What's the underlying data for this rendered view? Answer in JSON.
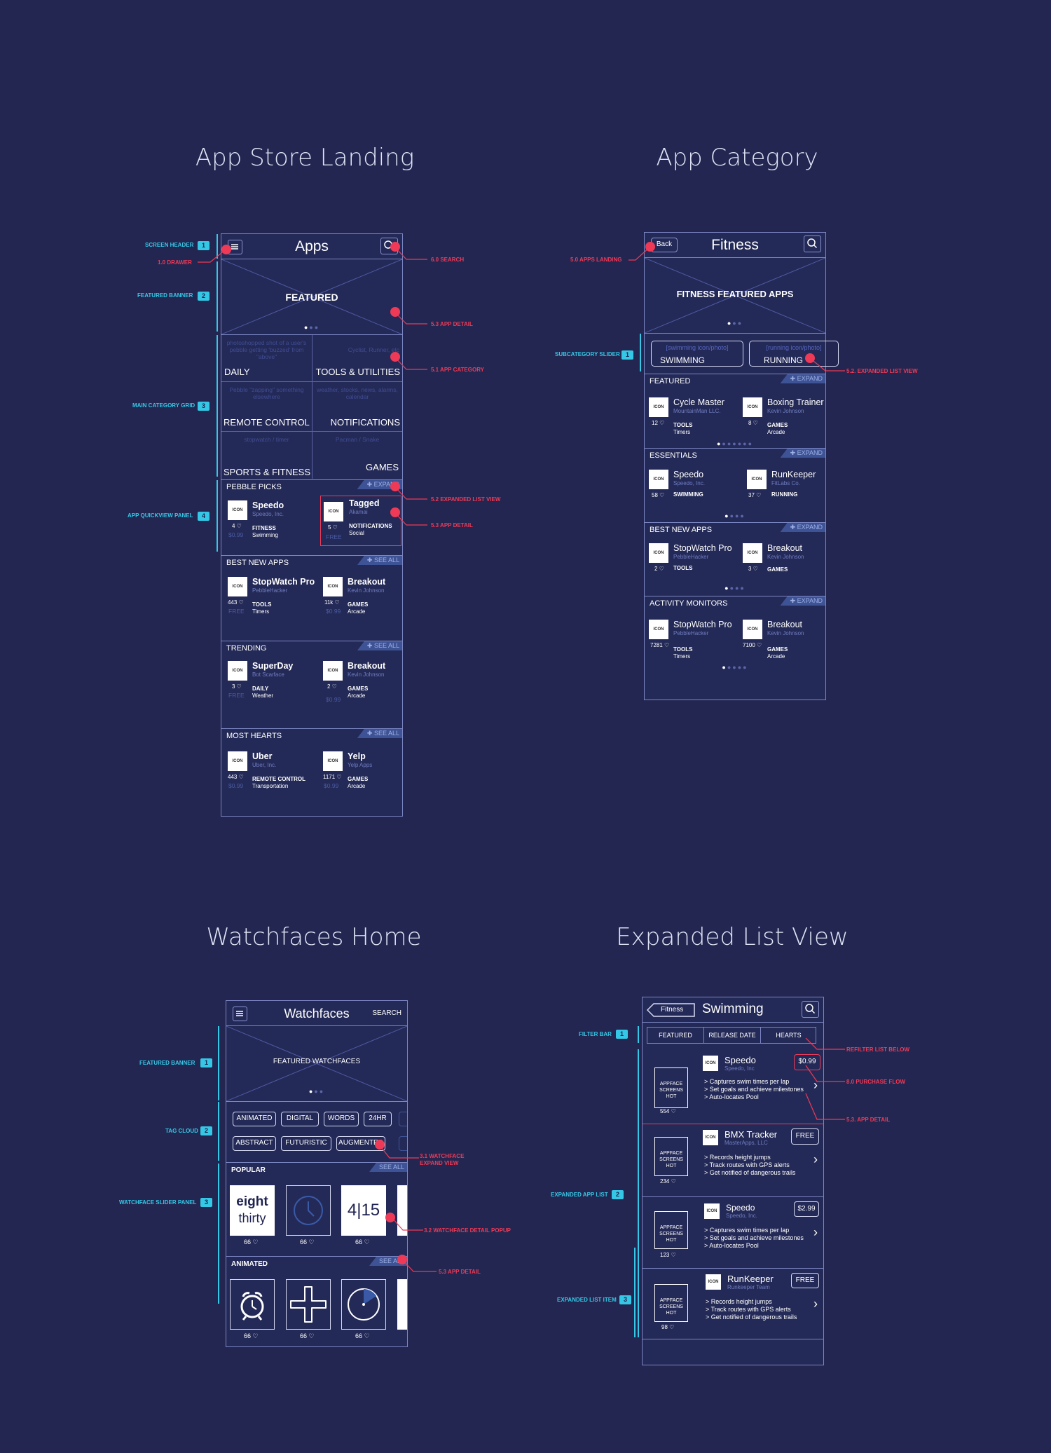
{
  "titles": {
    "landing": "App Store Landing",
    "category": "App Category",
    "watchfaces": "Watchfaces Home",
    "expanded": "Expanded List View"
  },
  "landing": {
    "header_title": "Apps",
    "banner": "FEATURED",
    "grid": [
      {
        "desc": "photoshopped shot of a user's pebble getting 'buzzed' from \"above\"",
        "name": "DAILY"
      },
      {
        "desc": "Cyclist, Runner, etc",
        "name": "TOOLS & UTILITIES"
      },
      {
        "desc": "Pebble \"zapping\" something elsewhere",
        "name": "REMOTE CONTROL"
      },
      {
        "desc": "weather, stocks, news, alarms, calendar",
        "name": "NOTIFICATIONS"
      },
      {
        "desc": "stopwatch / timer",
        "name": "SPORTS & FITNESS"
      },
      {
        "desc": "Pacman / Snake",
        "name": "GAMES"
      }
    ],
    "sections": [
      {
        "title": "PEBBLE PICKS",
        "action": "EXPAND",
        "apps": [
          {
            "icon": "ICON",
            "name": "Speedo",
            "dev": "Speedo, Inc.",
            "hearts": "4",
            "price": "$0.99",
            "cat": "FITNESS",
            "sub": "Swimming"
          },
          {
            "icon": "ICON",
            "name": "Tagged",
            "dev": "Akamai",
            "hearts": "5",
            "price": "FREE",
            "cat": "NOTIFICATIONS",
            "sub": "Social"
          }
        ]
      },
      {
        "title": "BEST NEW APPS",
        "action": "SEE ALL",
        "apps": [
          {
            "icon": "ICON",
            "name": "StopWatch Pro",
            "dev": "PebbleHacker",
            "hearts": "443",
            "price": "FREE",
            "cat": "TOOLS",
            "sub": "Timers"
          },
          {
            "icon": "ICON",
            "name": "Breakout",
            "dev": "Kevin Johnson",
            "hearts": "11k",
            "price": "$0.99",
            "cat": "GAMES",
            "sub": "Arcade"
          }
        ]
      },
      {
        "title": "TRENDING",
        "action": "SEE ALL",
        "apps": [
          {
            "icon": "ICON",
            "name": "SuperDay",
            "dev": "Bot Scarface",
            "hearts": "3",
            "price": "FREE",
            "cat": "DAILY",
            "sub": "Weather"
          },
          {
            "icon": "ICON",
            "name": "Breakout",
            "dev": "Kevin Johnson",
            "hearts": "2",
            "price": "$0.99",
            "cat": "GAMES",
            "sub": "Arcade"
          }
        ]
      },
      {
        "title": "MOST HEARTS",
        "action": "SEE ALL",
        "apps": [
          {
            "icon": "ICON",
            "name": "Uber",
            "dev": "Uber, Inc.",
            "hearts": "443",
            "price": "$0.99",
            "cat": "REMOTE CONTROL",
            "sub": "Transportation"
          },
          {
            "icon": "ICON",
            "name": "Yelp",
            "dev": "Yelp Apps",
            "hearts": "1171",
            "price": "$0.99",
            "cat": "GAMES",
            "sub": "Arcade"
          }
        ]
      }
    ],
    "annotations": {
      "screen_header": "SCREEN HEADER",
      "drawer": "1.0 DRAWER",
      "featured_banner": "FEATURED BANNER",
      "main_grid": "MAIN CATEGORY GRID",
      "quickview": "APP QUICKVIEW PANEL",
      "search": "6.0 SEARCH",
      "app_detail": "5.3 APP DETAIL",
      "app_category": "5.1 APP CATEGORY",
      "expanded": "5.2 EXPANDED LIST VIEW",
      "app_detail2": "5.3 APP DETAIL"
    }
  },
  "category": {
    "back": "Back",
    "header_title": "Fitness",
    "banner": "FITNESS FEATURED APPS",
    "subcats": [
      {
        "photo": "[swimming icon/photo]",
        "name": "SWIMMING"
      },
      {
        "photo": "[running icon/photo]",
        "name": "RUNNING"
      }
    ],
    "sections": [
      {
        "title": "FEATURED",
        "action": "EXPAND",
        "apps": [
          {
            "icon": "ICON",
            "name": "Cycle Master",
            "dev": "MountainMan LLC.",
            "hearts": "12",
            "cat": "TOOLS",
            "sub": "Timers"
          },
          {
            "icon": "ICON",
            "name": "Boxing Trainer",
            "dev": "Kevin Johnson",
            "hearts": "8",
            "cat": "GAMES",
            "sub": "Arcade"
          }
        ]
      },
      {
        "title": "ESSENTIALS",
        "action": "EXPAND",
        "apps": [
          {
            "icon": "ICON",
            "name": "Speedo",
            "dev": "Speedo, Inc.",
            "hearts": "58",
            "cat": "SWIMMING",
            "sub": ""
          },
          {
            "icon": "ICON",
            "name": "RunKeeper",
            "dev": "FitLabs Co.",
            "hearts": "37",
            "cat": "RUNNING",
            "sub": ""
          }
        ]
      },
      {
        "title": "BEST NEW APPS",
        "action": "EXPAND",
        "apps": [
          {
            "icon": "ICON",
            "name": "StopWatch Pro",
            "dev": "PebbleHacker",
            "hearts": "2",
            "cat": "TOOLS",
            "sub": ""
          },
          {
            "icon": "ICON",
            "name": "Breakout",
            "dev": "Kevin Johnson",
            "hearts": "3",
            "cat": "GAMES",
            "sub": ""
          }
        ]
      },
      {
        "title": "ACTIVITY MONITORS",
        "action": "EXPAND",
        "apps": [
          {
            "icon": "ICON",
            "name": "StopWatch Pro",
            "dev": "PebbleHacker",
            "hearts": "7281",
            "cat": "TOOLS",
            "sub": "Timers"
          },
          {
            "icon": "ICON",
            "name": "Breakout",
            "dev": "Kevin Johnson",
            "hearts": "7100",
            "cat": "GAMES",
            "sub": "Arcade"
          }
        ]
      }
    ],
    "annotations": {
      "apps_landing": "5.0 APPS LANDING",
      "subcat_slider": "SUBCATEGORY SLIDER",
      "expanded": "5.2. EXPANDED LIST VIEW"
    }
  },
  "watchfaces": {
    "header_title": "Watchfaces",
    "search": "SEARCH",
    "banner": "FEATURED WATCHFACES",
    "tags_row1": [
      "ANIMATED",
      "DIGITAL",
      "WORDS",
      "24HR"
    ],
    "tags_row2": [
      "ABSTRACT",
      "FUTURISTIC",
      "AUGMENTED"
    ],
    "popular": {
      "title": "POPULAR",
      "action": "SEE ALL",
      "counts": [
        "66",
        "66",
        "66"
      ],
      "face1_line1": "eight",
      "face1_line2": "thirty",
      "face3": "4|15"
    },
    "animated": {
      "title": "ANIMATED",
      "action": "SEE ALL",
      "counts": [
        "66",
        "66",
        "66"
      ]
    },
    "annotations": {
      "featured_banner": "FEATURED BANNER",
      "tag_cloud": "TAG CLOUD",
      "slider": "WATCHFACE SLIDER PANEL",
      "expand_view": "3.1 WATCHFACE EXPAND VIEW",
      "detail_popup": "3.2 WATCHFACE DETAIL POPUP",
      "app_detail": "5.3 APP DETAIL"
    }
  },
  "expanded": {
    "back": "Fitness",
    "header_title": "Swimming",
    "filters": [
      "FEATURED",
      "RELEASE DATE",
      "HEARTS"
    ],
    "items": [
      {
        "shot": "APPFACE SCREENS HOT",
        "count": "554",
        "icon": "ICON",
        "name": "Speedo",
        "dev": "Speedo, Inc",
        "price": "$0.99",
        "bullets": [
          "> Captures swim times per lap",
          "> Set goals and achieve milestones",
          "> Auto-locates Pool"
        ]
      },
      {
        "shot": "APPFACE SCREENS HOT",
        "count": "234",
        "icon": "ICON",
        "name": "BMX Tracker",
        "dev": "MasterApps, LLC",
        "price": "FREE",
        "bullets": [
          "> Records height jumps",
          "> Track routes with GPS alerts",
          "> Get notified of dangerous trails"
        ]
      },
      {
        "shot": "APPFACE SCREENS HOT",
        "count": "123",
        "icon": "ICON",
        "name": "Speedo",
        "dev": "Speedo, Inc.",
        "price": "$2.99",
        "bullets": [
          "> Captures swim times per lap",
          "> Set goals and achieve milestones",
          "> Auto-locates Pool"
        ]
      },
      {
        "shot": "APPFACE SCREENS HOT",
        "count": "98",
        "icon": "ICON",
        "name": "RunKeeper",
        "dev": "Runkeeper Team",
        "price": "FREE",
        "bullets": [
          "> Records height jumps",
          "> Track routes with GPS alerts",
          "> Get notified of dangerous trails"
        ]
      }
    ],
    "annotations": {
      "filter_bar": "FILTER BAR",
      "refilter": "REFILTER LIST BELOW",
      "purchase": "8.0 PURCHASE FLOW",
      "app_detail": "5.3. APP DETAIL",
      "list": "EXPANDED APP LIST",
      "list_item": "EXPANDED LIST ITEM"
    }
  },
  "colors": {
    "background": "#232650",
    "accent_cyan": "#35c8e6",
    "accent_red": "#ee3a57",
    "line": "#7b85c2"
  }
}
